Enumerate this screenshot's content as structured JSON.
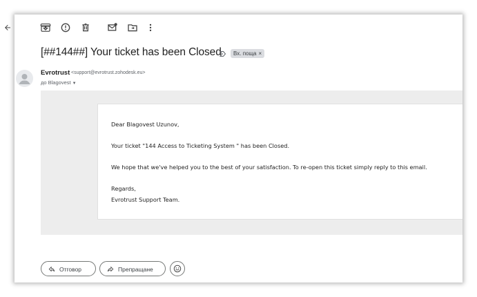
{
  "toolbar": {
    "back": "back-arrow-icon",
    "archive": "archive-icon",
    "report": "report-spam-icon",
    "delete": "trash-icon",
    "mark_unread": "mark-unread-icon",
    "move": "move-to-folder-icon",
    "more": "more-vert-icon"
  },
  "message": {
    "subject": "[##144##] Your ticket has been Closed",
    "label": "Вх. поща",
    "label_close": "×",
    "sender_name": "Evrotrust",
    "sender_email": "<support@evrotrust.zohodesk.eu>",
    "recipient": "до Blagovest",
    "recipient_caret": "▼"
  },
  "email_body": {
    "greeting": "Dear Blagovest Uzunov,",
    "line1": "Your ticket \"144 Access to Ticketing System \" has been Closed.",
    "line2": "We hope that we've helped you to the best of your satisfaction. To re-open this ticket simply reply to this email.",
    "regards": "Regards,",
    "signature": "Evrotrust Support Team."
  },
  "actions": {
    "reply_label": "Отговор",
    "forward_label": "Препращане"
  },
  "colors": {
    "body_background": "#ededed",
    "chip_background": "#dadce0",
    "text": "#1f1f1f"
  }
}
